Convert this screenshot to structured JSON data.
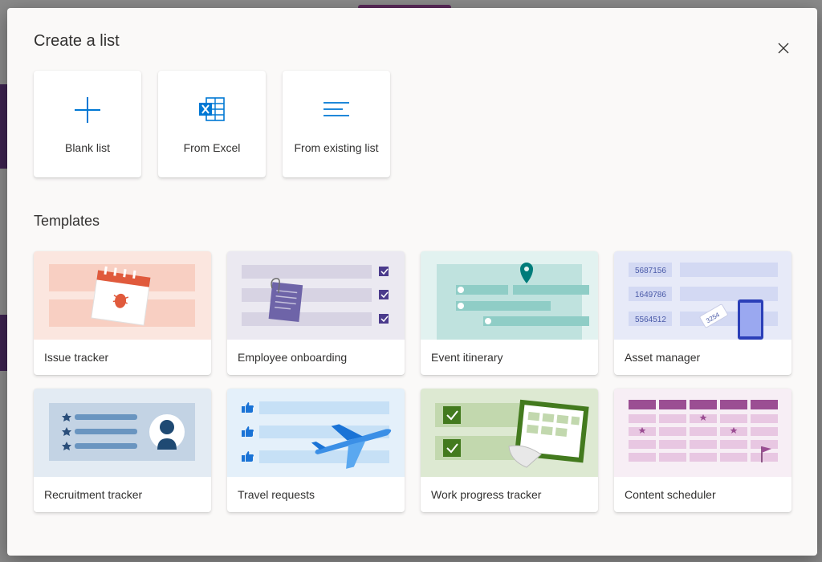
{
  "dialog": {
    "title": "Create a list",
    "close_icon": "close-icon"
  },
  "create_options": [
    {
      "label": "Blank list",
      "icon": "plus-icon",
      "color": "#0078d4"
    },
    {
      "label": "From Excel",
      "icon": "excel-icon",
      "color": "#0078d4"
    },
    {
      "label": "From existing list",
      "icon": "list-lines-icon",
      "color": "#0078d4"
    }
  ],
  "templates_title": "Templates",
  "templates": [
    {
      "label": "Issue tracker",
      "bg": "#fbe6df"
    },
    {
      "label": "Employee onboarding",
      "bg": "#ebe9f1"
    },
    {
      "label": "Event itinerary",
      "bg": "#e2f2f0"
    },
    {
      "label": "Asset manager",
      "bg": "#e7eaf8"
    },
    {
      "label": "Recruitment tracker",
      "bg": "#e3ebf3"
    },
    {
      "label": "Travel requests",
      "bg": "#e4f0fa"
    },
    {
      "label": "Work progress tracker",
      "bg": "#dde9d2"
    },
    {
      "label": "Content scheduler",
      "bg": "#f7eef5"
    }
  ],
  "asset_ids": [
    "5687156",
    "1649786",
    "5564512"
  ],
  "asset_tag": "3254"
}
